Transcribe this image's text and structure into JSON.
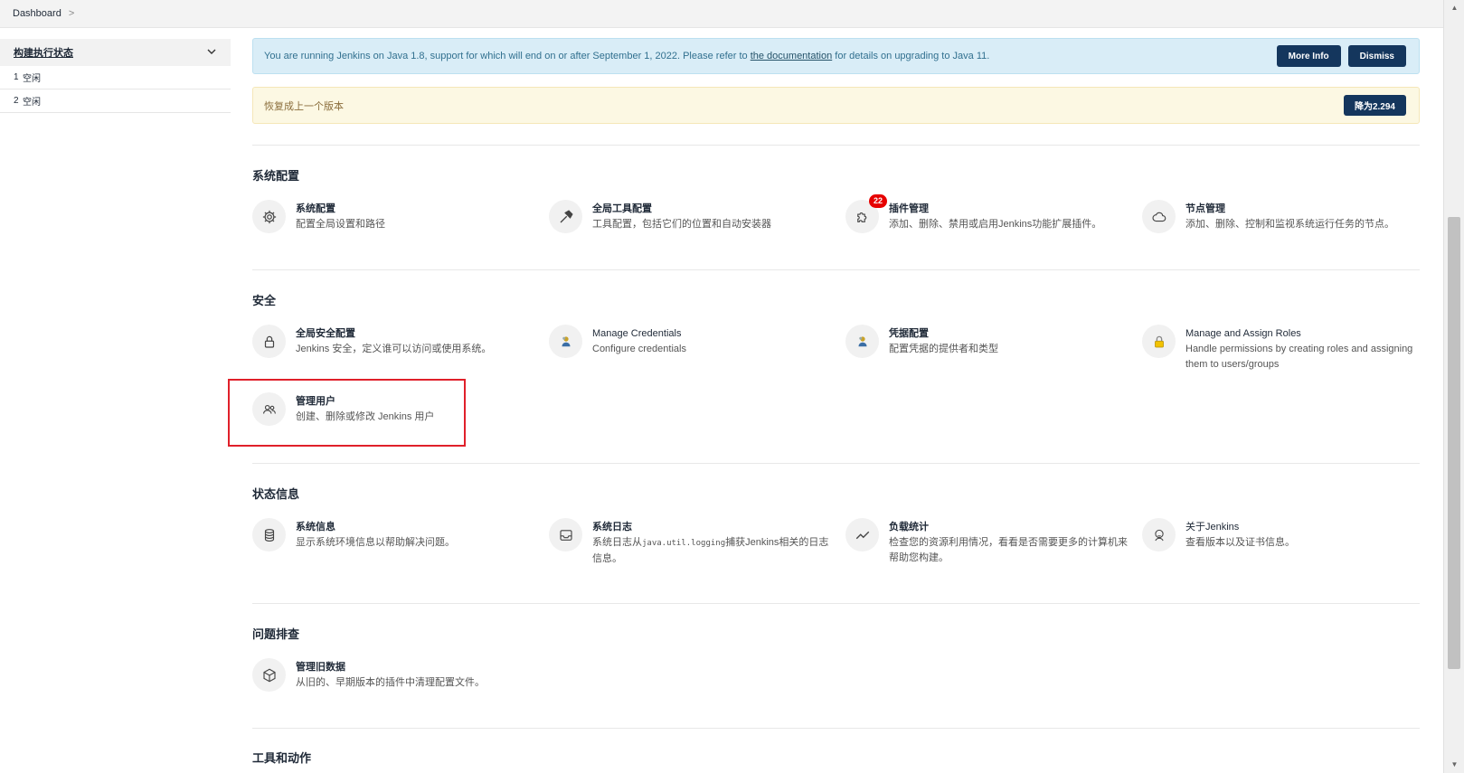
{
  "breadcrumb": {
    "root": "Dashboard",
    "separator": ">"
  },
  "executor": {
    "title": "构建执行状态",
    "rows": [
      {
        "num": "1",
        "status": "空闲"
      },
      {
        "num": "2",
        "status": "空闲"
      }
    ]
  },
  "alerts": {
    "java": {
      "text_before": "You are running Jenkins on Java 1.8, support for which will end on or after September 1, 2022. Please refer to ",
      "link": "the documentation",
      "text_after": " for details on upgrading to Java 11.",
      "more_info": "More Info",
      "dismiss": "Dismiss"
    },
    "restore": {
      "text": "恢复成上一个版本",
      "button": "降为2.294"
    }
  },
  "sections": {
    "system_config": {
      "title": "系统配置",
      "items": [
        {
          "title": "系统配置",
          "desc": "配置全局设置和路径"
        },
        {
          "title": "全局工具配置",
          "desc": "工具配置，包括它们的位置和自动安装器"
        },
        {
          "title": "插件管理",
          "desc": "添加、删除、禁用或启用Jenkins功能扩展插件。",
          "badge": "22"
        },
        {
          "title": "节点管理",
          "desc": "添加、删除、控制和监视系统运行任务的节点。"
        }
      ]
    },
    "security": {
      "title": "安全",
      "items": [
        {
          "title": "全局安全配置",
          "desc": "Jenkins 安全，定义谁可以访问或使用系统。"
        },
        {
          "title": "Manage Credentials",
          "desc": "Configure credentials"
        },
        {
          "title": "凭据配置",
          "desc": "配置凭据的提供者和类型"
        },
        {
          "title": "Manage and Assign Roles",
          "desc_line1": "Handle permissions by creating roles and assigning",
          "desc_line2": "them to users/groups"
        },
        {
          "title": "管理用户",
          "desc": "创建、删除或修改 Jenkins 用户"
        }
      ]
    },
    "status": {
      "title": "状态信息",
      "items": [
        {
          "title": "系统信息",
          "desc": "显示系统环境信息以帮助解决问题。"
        },
        {
          "title": "系统日志",
          "desc_prefix": "系统日志从",
          "desc_code": "java.util.logging",
          "desc_suffix": "捕获Jenkins相关的日志",
          "desc_line2": "信息。"
        },
        {
          "title": "负载统计",
          "desc_line1": "检查您的资源利用情况，看看是否需要更多的计算机来",
          "desc_line2": "帮助您构建。"
        },
        {
          "title": "关于Jenkins",
          "desc": "查看版本以及证书信息。"
        }
      ]
    },
    "troubleshoot": {
      "title": "问题排查",
      "items": [
        {
          "title": "管理旧数据",
          "desc": "从旧的、早期版本的插件中清理配置文件。"
        }
      ]
    },
    "tools": {
      "title": "工具和动作"
    }
  },
  "icons": {
    "gear": "gear-icon",
    "hammer": "hammer-icon",
    "puzzle": "puzzle-icon",
    "cloud": "cloud-icon",
    "lock": "lock-icon",
    "credentials": "credentials-icon",
    "padlock_yellow": "padlock-icon",
    "users": "users-icon",
    "database": "database-icon",
    "inbox": "inbox-icon",
    "chart": "line-chart-icon",
    "jenkins": "jenkins-icon",
    "box": "box-icon"
  },
  "colors": {
    "primary_button": "#14365d",
    "info_bg": "#d9edf7",
    "warn_bg": "#fcf8e3",
    "badge": "#e60000",
    "highlight": "#e0202a"
  }
}
